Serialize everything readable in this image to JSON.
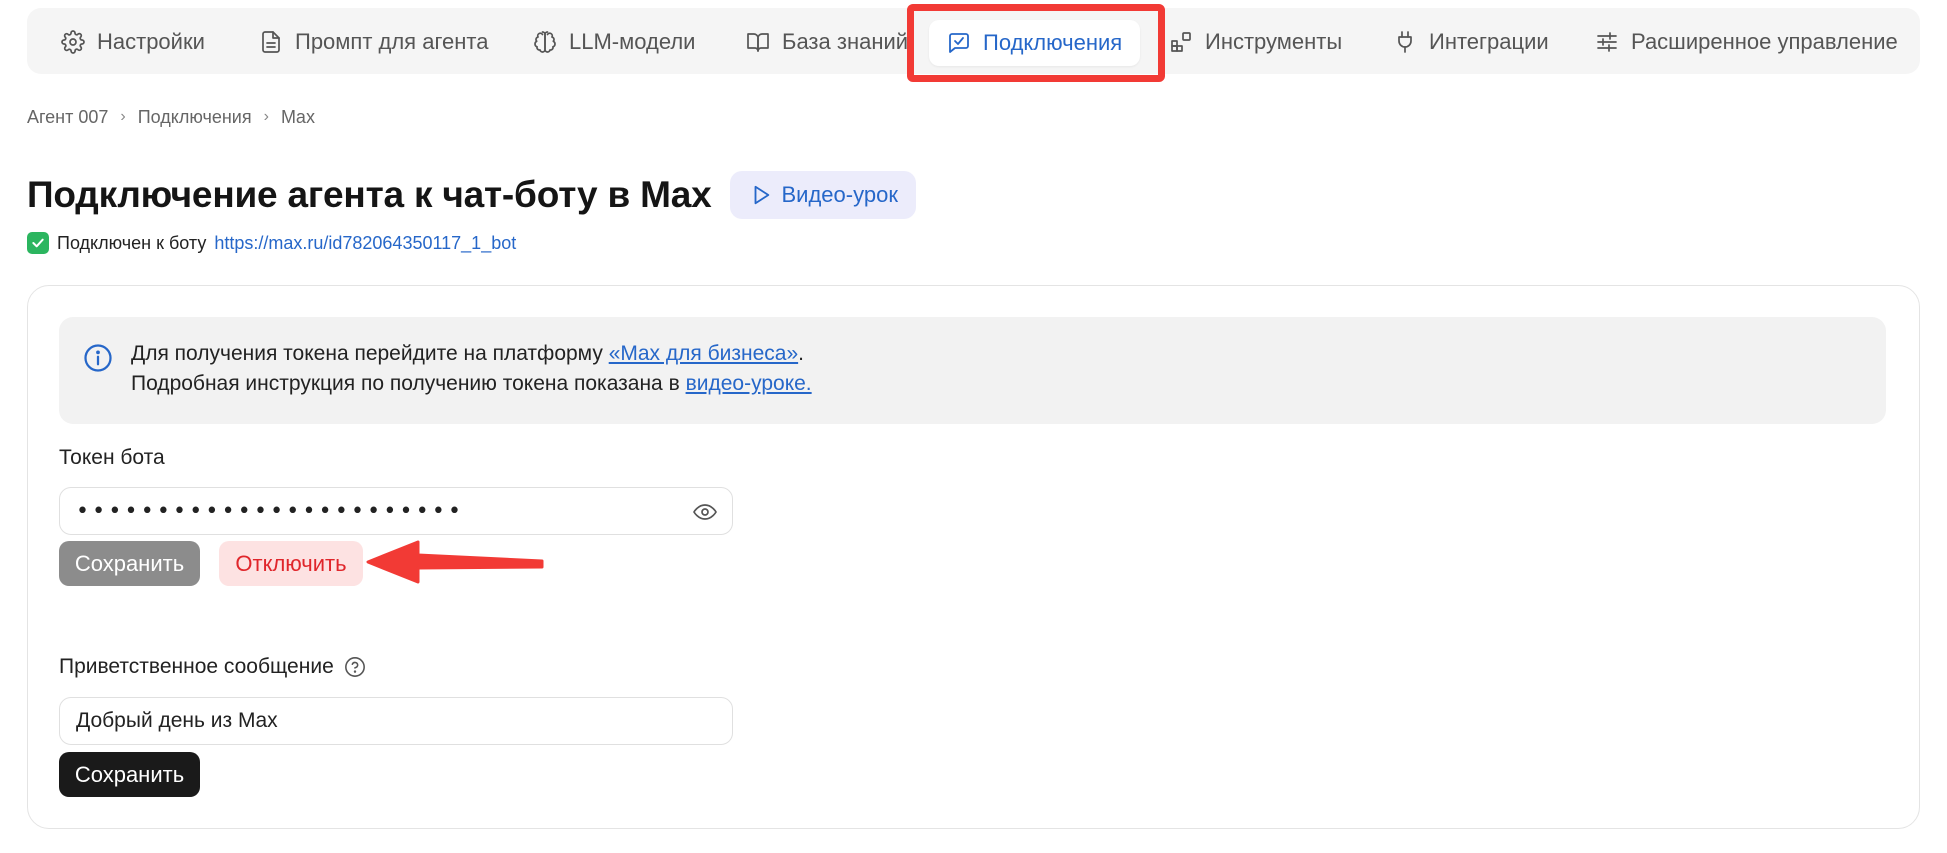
{
  "tabs": [
    {
      "label": "Настройки",
      "icon": "gear-icon"
    },
    {
      "label": "Промпт для агента",
      "icon": "document-icon"
    },
    {
      "label": "LLM-модели",
      "icon": "brain-icon"
    },
    {
      "label": "База знаний",
      "icon": "book-icon"
    },
    {
      "label": "Подключения",
      "icon": "chat-check-icon",
      "active": true
    },
    {
      "label": "Инструменты",
      "icon": "blocks-icon"
    },
    {
      "label": "Интеграции",
      "icon": "plug-icon"
    },
    {
      "label": "Расширенное управление",
      "icon": "sliders-icon"
    }
  ],
  "breadcrumb": [
    "Агент 007",
    "Подключения",
    "Max"
  ],
  "header": {
    "title": "Подключение агента к чат-боту в Max",
    "video_button": "Видео-урок"
  },
  "status": {
    "text": "Подключен к боту",
    "link": "https://max.ru/id782064350117_1_bot"
  },
  "info": {
    "line1_prefix": "Для получения токена перейдите на платформу",
    "line1_link": "«Max для бизнеса»",
    "line1_suffix": ".",
    "line2_prefix": "Подробная инструкция по получению токена показана в",
    "line2_link": "видео-уроке."
  },
  "token": {
    "label": "Токен бота",
    "value": "••••••••••••••••••••••••",
    "save_label": "Сохранить",
    "disconnect_label": "Отключить"
  },
  "greeting": {
    "label": "Приветственное сообщение",
    "value": "Добрый день из Max",
    "save_label": "Сохранить"
  },
  "colors": {
    "accent": "#2667c9",
    "annotation": "#f23a35",
    "success": "#2bb55f",
    "danger": "#e0262b"
  }
}
